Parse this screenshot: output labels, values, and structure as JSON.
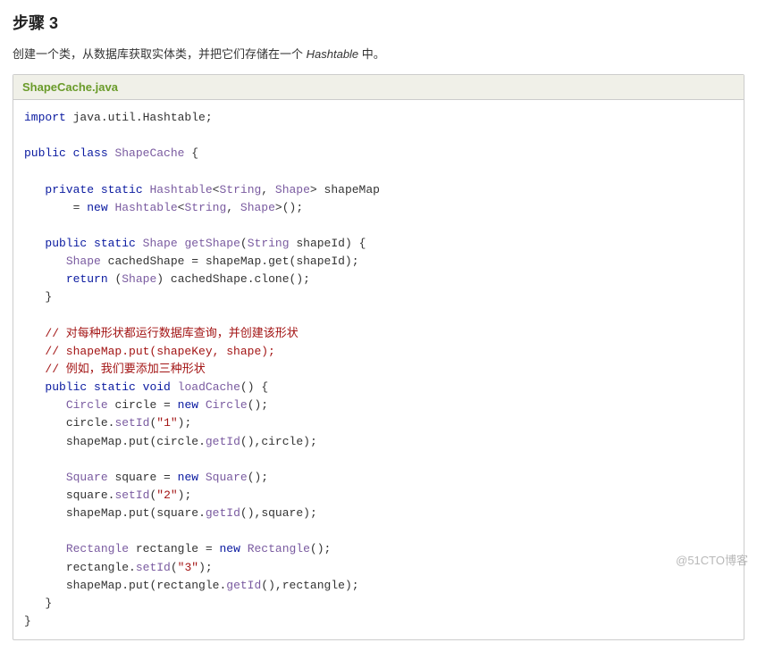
{
  "step_title": "步骤 3",
  "description_before": "创建一个类，从数据库获取实体类，并把它们存储在一个 ",
  "description_em": "Hashtable",
  "description_after": " 中。",
  "file_name": "ShapeCache.java",
  "watermark": "@51CTO博客",
  "code": {
    "import_kw": "import",
    "import_pkg": " java.util.Hashtable;",
    "public_kw": "public",
    "class_kw": "class",
    "class_name": " ShapeCache ",
    "brace_open": "{",
    "brace_close": "}",
    "private_kw": "private",
    "static_kw": "static",
    "void_kw": "void",
    "return_kw": "return",
    "new_kw": "new",
    "type_hashtable": "Hashtable",
    "type_string": "String",
    "type_shape": "Shape",
    "type_circle": "Circle",
    "type_square": "Square",
    "type_rectangle": "Rectangle",
    "lt": "<",
    "gt": ">",
    "comma_sp": ", ",
    "field_name": " shapeMap",
    "eq": " = ",
    "paren_pair": "()",
    "semicolon": ";",
    "method_getshape": "getShape",
    "param_getshape": "shapeId",
    "lparen": "(",
    "rparen": ")",
    "sp": " ",
    "var_cachedshape": "cachedShape",
    "call_shapemap_get": "shapeMap.get",
    "call_cachedshape_clone": "cachedShape.clone",
    "cast_open": "(",
    "cast_close": ")",
    "comment1": "// 对每种形状都运行数据库查询，并创建该形状",
    "comment2": "// shapeMap.put(shapeKey, shape);",
    "comment3": "// 例如，我们要添加三种形状",
    "method_loadcache": "loadCache",
    "var_circle": "circle",
    "var_square": "square",
    "var_rectangle": "rectangle",
    "call_setid": "setId",
    "call_getid": "getId",
    "call_shapemap_put": "shapeMap.put",
    "str_1": "\"1\"",
    "str_2": "\"2\"",
    "str_3": "\"3\"",
    "dot": ".",
    "comma": ","
  }
}
